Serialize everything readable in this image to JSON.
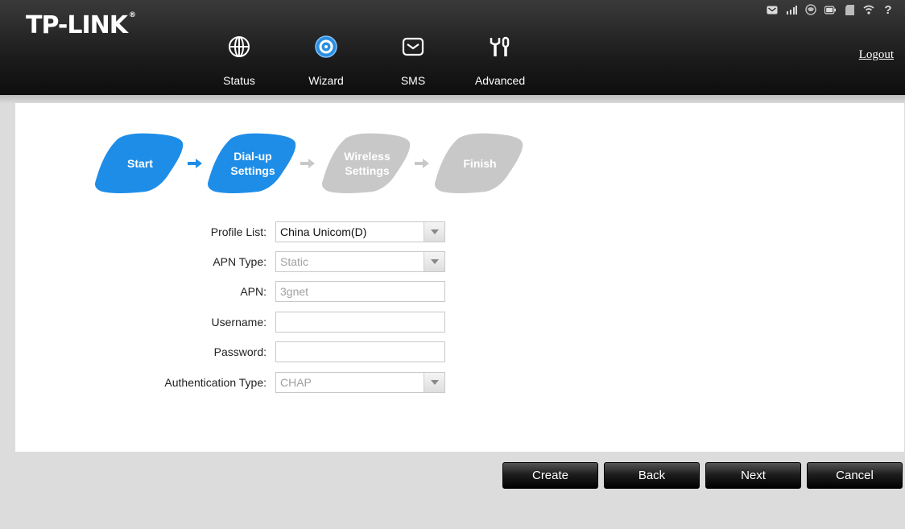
{
  "brand": {
    "logo": "TP-LINK",
    "reg": "®"
  },
  "nav": [
    {
      "label": "Status",
      "icon": "globe-icon"
    },
    {
      "label": "Wizard",
      "icon": "gear-icon"
    },
    {
      "label": "SMS",
      "icon": "envelope-icon"
    },
    {
      "label": "Advanced",
      "icon": "tools-icon"
    }
  ],
  "active_nav": "Wizard",
  "status_icons": [
    "message-icon",
    "signal-icon",
    "network-icon",
    "battery-icon",
    "sdcard-icon",
    "wifi-icon",
    "help-icon"
  ],
  "logout_label": "Logout",
  "wizard": {
    "steps": [
      {
        "label_line1": "Start",
        "label_line2": "",
        "state": "done"
      },
      {
        "label_line1": "Dial-up",
        "label_line2": "Settings",
        "state": "active"
      },
      {
        "label_line1": "Wireless",
        "label_line2": "Settings",
        "state": "pending"
      },
      {
        "label_line1": "Finish",
        "label_line2": "",
        "state": "pending"
      }
    ],
    "colors": {
      "active": "#1e8de8",
      "pending": "#c8c8c8"
    }
  },
  "form": {
    "profile_list": {
      "label": "Profile List:",
      "value": "China Unicom(D)"
    },
    "apn_type": {
      "label": "APN Type:",
      "value": "Static"
    },
    "apn": {
      "label": "APN:",
      "value": "3gnet"
    },
    "username": {
      "label": "Username:",
      "value": ""
    },
    "password": {
      "label": "Password:",
      "value": ""
    },
    "auth_type": {
      "label": "Authentication Type:",
      "value": "CHAP"
    }
  },
  "buttons": {
    "create": "Create",
    "back": "Back",
    "next": "Next",
    "cancel": "Cancel"
  }
}
